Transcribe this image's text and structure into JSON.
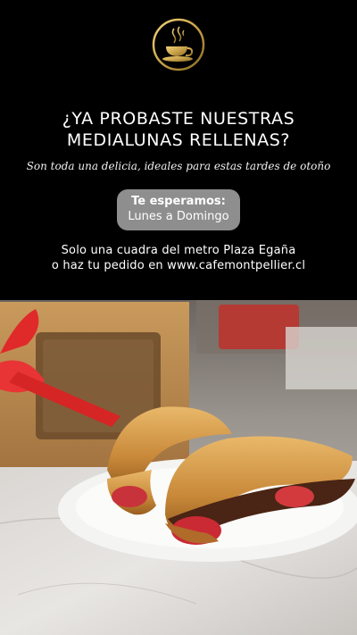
{
  "brand": {
    "logo_icon": "coffee-cup-logo-icon",
    "accent_color": "#c9a24a"
  },
  "headline": {
    "line1": "¿YA PROBASTE NUESTRAS",
    "line2": "MEDIALUNAS RELLENAS?"
  },
  "tagline": "Son toda una delicia, ideales para estas tardes de otoño",
  "schedule": {
    "title": "Te esperamos:",
    "days": "Lunes a Domingo"
  },
  "info": {
    "line1": "Solo una cuadra del metro Plaza Egaña",
    "line2": "o haz tu pedido en www.cafemontpellier.cl"
  },
  "photo": {
    "subject": "croissants-with-strawberries-and-chocolate-photo"
  }
}
